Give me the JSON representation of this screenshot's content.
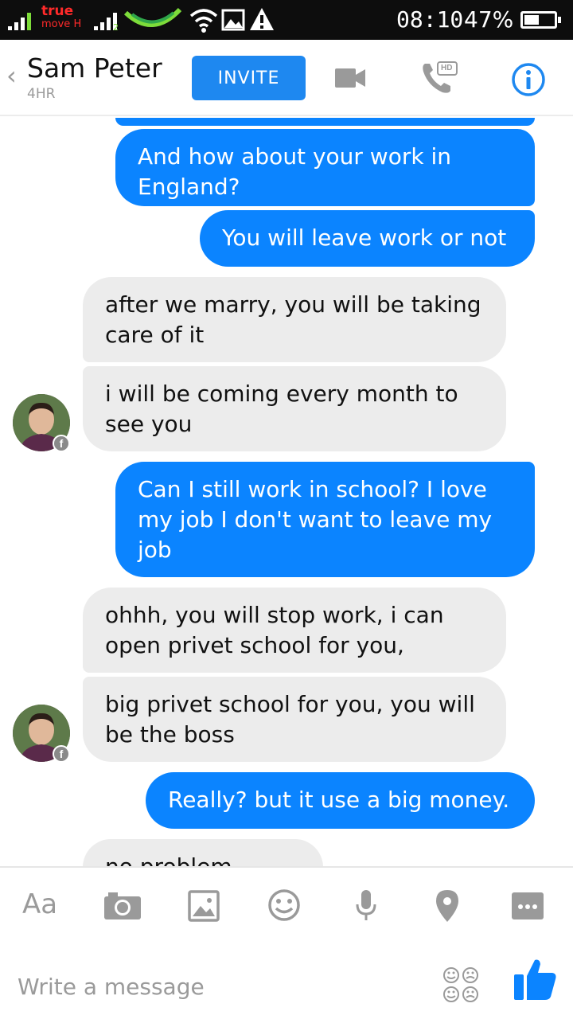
{
  "status_bar": {
    "carrier_line1": "true",
    "carrier_line2": "move H",
    "sim2_label": "2",
    "time": "08:10",
    "battery": "47%"
  },
  "header": {
    "contact_name": "Sam Peter",
    "contact_status": "4HR",
    "invite_label": "INVITE",
    "hd_label": "HD",
    "icons": [
      "back-chevron-icon",
      "video-camera-icon",
      "phone-hd-icon",
      "info-icon"
    ]
  },
  "colors": {
    "outgoing_bubble": "#0b84ff",
    "incoming_bubble": "#ececec",
    "accent": "#1e88f0"
  },
  "messages": [
    {
      "direction": "out",
      "text": "And how about your work in England?"
    },
    {
      "direction": "out",
      "text": "You will leave work or not"
    },
    {
      "direction": "in",
      "text": "after we marry, you will be taking care of it"
    },
    {
      "direction": "in",
      "text": "i will be coming every month to see you"
    },
    {
      "direction": "out",
      "text": "Can I still work in school? I love my job I don't want to leave my job"
    },
    {
      "direction": "in",
      "text": "ohhh, you will stop work, i can open privet school for you,"
    },
    {
      "direction": "in",
      "text": "big privet school for you, you will be the boss"
    },
    {
      "direction": "out",
      "text": "Really? but it use a big money."
    },
    {
      "direction": "in",
      "text": "no problem honey"
    }
  ],
  "composer": {
    "text_format_label": "Aa",
    "placeholder": "Write a message",
    "tools": [
      "camera-icon",
      "gallery-icon",
      "emoji-icon",
      "microphone-icon",
      "location-icon",
      "more-icon",
      "stickers-icon",
      "like-icon"
    ]
  }
}
